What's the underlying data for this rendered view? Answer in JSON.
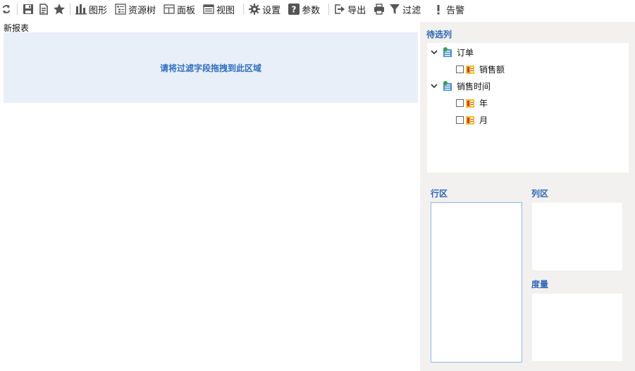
{
  "toolbar": {
    "items": [
      {
        "icon": "refresh-icon",
        "label": ""
      },
      {
        "icon": "save-icon",
        "label": ""
      },
      {
        "icon": "save-as-icon",
        "label": ""
      },
      {
        "icon": "star-icon",
        "label": ""
      },
      {
        "icon": "chart-icon",
        "label": "图形"
      },
      {
        "icon": "resource-tree-icon",
        "label": "资源树"
      },
      {
        "icon": "panel-icon",
        "label": "面板"
      },
      {
        "icon": "view-icon",
        "label": "视图"
      },
      {
        "icon": "gear-icon",
        "label": "设置"
      },
      {
        "icon": "question-icon",
        "label": "参数"
      },
      {
        "icon": "export-icon",
        "label": "导出"
      },
      {
        "icon": "print-icon",
        "label": ""
      },
      {
        "icon": "filter-icon",
        "label": "过滤"
      },
      {
        "icon": "alert-icon",
        "label": "告警"
      }
    ]
  },
  "report": {
    "title": "新报表",
    "filter_placeholder": "请将过滤字段拖拽到此区域"
  },
  "panel": {
    "candidate_header": "待选列",
    "tree": [
      {
        "label": "订单",
        "children": [
          {
            "label": "销售额"
          }
        ]
      },
      {
        "label": "销售时间",
        "children": [
          {
            "label": "年"
          },
          {
            "label": "月"
          }
        ]
      }
    ],
    "row_zone": "行区",
    "column_zone": "列区",
    "measure_zone": "度量"
  },
  "colors": {
    "accent": "#2c66b6",
    "filter_bg": "#e8eff8",
    "panel_bg": "#f2f1ef"
  }
}
